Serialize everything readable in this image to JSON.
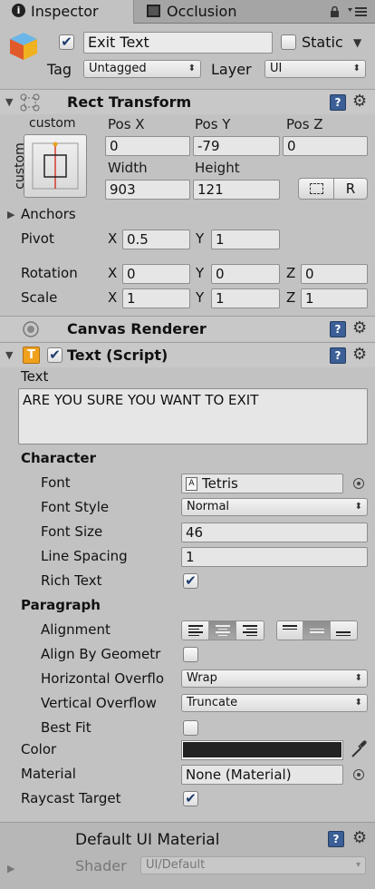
{
  "tabs": [
    {
      "label": "Inspector",
      "icon": "info-icon"
    },
    {
      "label": "Occlusion",
      "icon": "occlusion-icon"
    }
  ],
  "object": {
    "active": true,
    "name": "Exit Text",
    "static_label": "Static",
    "static_checked": false,
    "tag_label": "Tag",
    "tag_value": "Untagged",
    "layer_label": "Layer",
    "layer_value": "UI"
  },
  "rect_transform": {
    "title": "Rect Transform",
    "anchor_preset_top": "custom",
    "anchor_preset_side": "custom",
    "pos_x_label": "Pos X",
    "pos_x": "0",
    "pos_y_label": "Pos Y",
    "pos_y": "-79",
    "pos_z_label": "Pos Z",
    "pos_z": "0",
    "width_label": "Width",
    "width": "903",
    "height_label": "Height",
    "height": "121",
    "r_button": "R",
    "anchors_label": "Anchors",
    "pivot_label": "Pivot",
    "pivot_x": "0.5",
    "pivot_y": "1",
    "rotation_label": "Rotation",
    "rot_x": "0",
    "rot_y": "0",
    "rot_z": "0",
    "scale_label": "Scale",
    "scale_x": "1",
    "scale_y": "1",
    "scale_z": "1",
    "x": "X",
    "y": "Y",
    "z": "Z"
  },
  "canvas_renderer": {
    "title": "Canvas Renderer"
  },
  "text_script": {
    "title": "Text (Script)",
    "enabled": true,
    "text_label": "Text",
    "text_value": "ARE YOU SURE YOU WANT TO EXIT",
    "character_label": "Character",
    "font_label": "Font",
    "font_value": "Tetris",
    "font_style_label": "Font Style",
    "font_style_value": "Normal",
    "font_size_label": "Font Size",
    "font_size_value": "46",
    "line_spacing_label": "Line Spacing",
    "line_spacing_value": "1",
    "rich_text_label": "Rich Text",
    "rich_text": true,
    "paragraph_label": "Paragraph",
    "alignment_label": "Alignment",
    "align_by_geometry_label": "Align By Geometr",
    "align_by_geometry": false,
    "horizontal_overflow_label": "Horizontal Overflo",
    "horizontal_overflow_value": "Wrap",
    "vertical_overflow_label": "Vertical Overflow",
    "vertical_overflow_value": "Truncate",
    "best_fit_label": "Best Fit",
    "best_fit": false,
    "color_label": "Color",
    "color_value": "#222222",
    "material_label": "Material",
    "material_value": "None (Material)",
    "raycast_label": "Raycast Target",
    "raycast": true
  },
  "material": {
    "title": "Default UI Material",
    "shader_label": "Shader",
    "shader_value": "UI/Default"
  },
  "colors": {
    "panel_bg": "#c2c2c2",
    "accent_blue": "#3b5f96"
  }
}
